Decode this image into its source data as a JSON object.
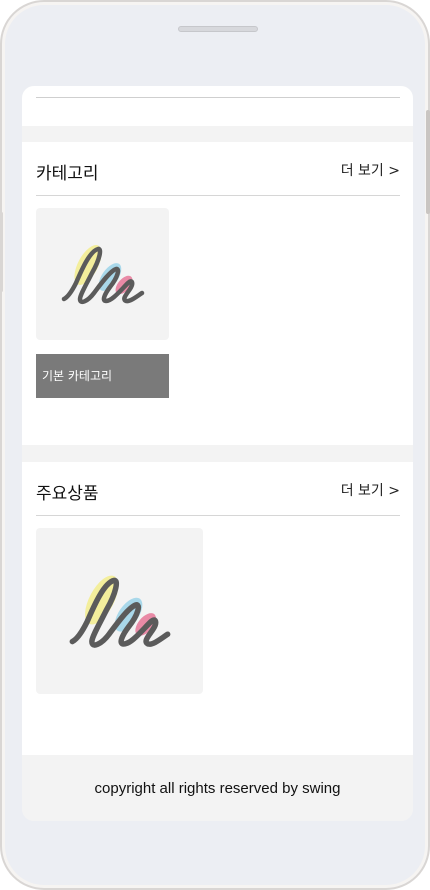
{
  "categories_section": {
    "title": "카테고리",
    "more_label": "더 보기 >",
    "items": [
      {
        "label": "기본 카테고리"
      }
    ]
  },
  "products_section": {
    "title": "주요상품",
    "more_label": "더 보기 >"
  },
  "footer": {
    "copyright": "copyright all rights reserved by swing"
  },
  "colors": {
    "logo_yellow": "#f3ee9c",
    "logo_blue": "#a9d8ea",
    "logo_pink": "#e98aa6",
    "logo_stroke": "#5b5b5b",
    "label_bg": "#7a7a7a"
  }
}
